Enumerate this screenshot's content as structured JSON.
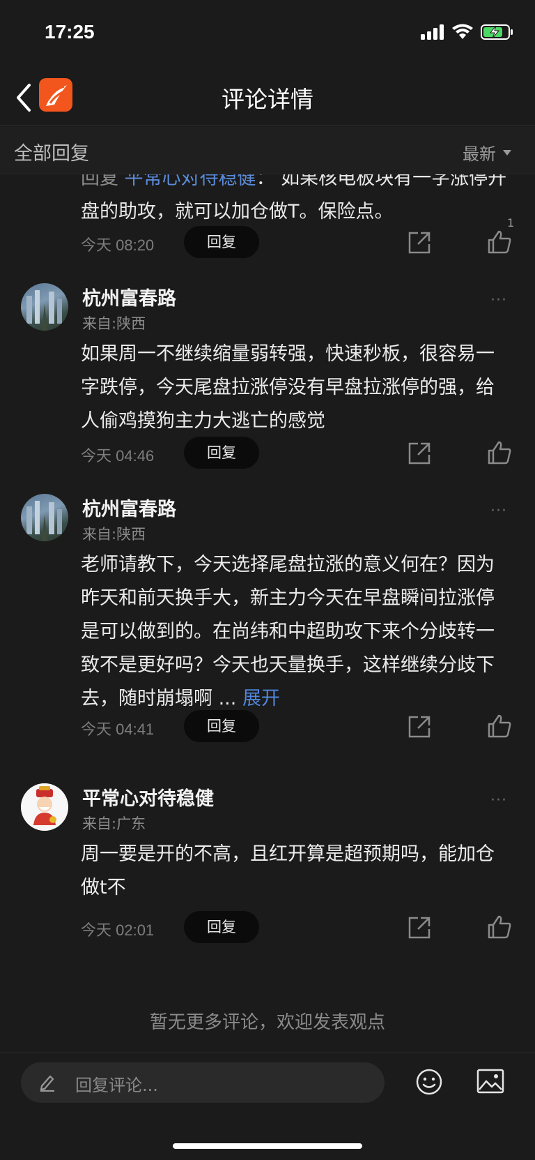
{
  "status": {
    "time": "17:25"
  },
  "nav": {
    "title": "评论详情"
  },
  "filter": {
    "left": "全部回复",
    "sort": "最新"
  },
  "partial_reply": {
    "prefix": "回复",
    "mention": "平常心对待稳健",
    "text": "：  如果核电板块有一字涨停开盘的助攻，就可以加仓做T。保险点。",
    "time": "今天 08:20",
    "reply_label": "回复",
    "likes": "1"
  },
  "comments": [
    {
      "user": "杭州富春路",
      "location": "来自:陕西",
      "text": "如果周一不继续缩量弱转强，快速秒板，很容易一字跌停，今天尾盘拉涨停没有早盘拉涨停的强，给人偷鸡摸狗主力大逃亡的感觉",
      "time": "今天 04:46",
      "reply_label": "回复"
    },
    {
      "user": "杭州富春路",
      "location": "来自:陕西",
      "text": "老师请教下，今天选择尾盘拉涨的意义何在？因为昨天和前天换手大，新主力今天在早盘瞬间拉涨停是可以做到的。在尚纬和中超助攻下来个分歧转一致不是更好吗？今天也天量换手，这样继续分歧下去，随时崩塌啊 ...",
      "expand": "展开",
      "time": "今天 04:41",
      "reply_label": "回复"
    },
    {
      "user": "平常心对待稳健",
      "location": "来自:广东",
      "text": "周一要是开的不高，且红开算是超预期吗，能加仓做t不",
      "time": "今天 02:01",
      "reply_label": "回复"
    }
  ],
  "footer": {
    "no_more": "暂无更多评论，欢迎发表观点"
  },
  "input": {
    "placeholder": "回复评论..."
  },
  "more_glyph": "···",
  "colors": {
    "background": "#1b1b1b",
    "link": "#5b8bd8",
    "brand": "#f2561d"
  }
}
